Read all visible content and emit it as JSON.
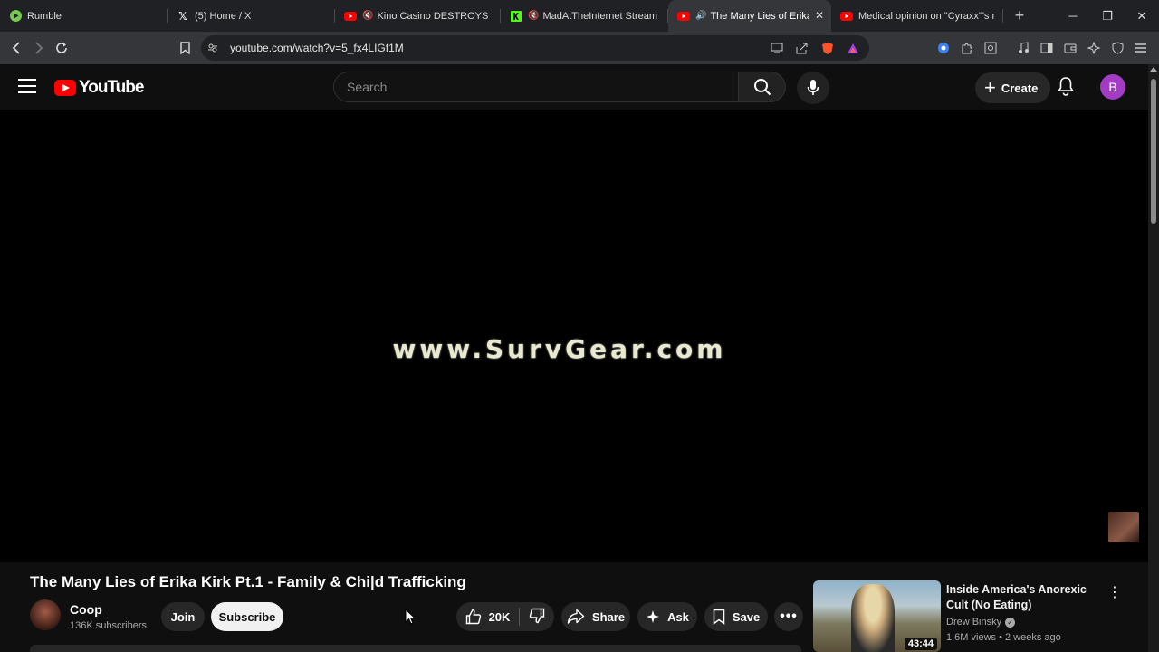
{
  "browser": {
    "tabs": [
      {
        "title": "Rumble",
        "icon": "rumble-icon",
        "color": "#75c94e"
      },
      {
        "title": "(5) Home / X",
        "icon": "x-icon",
        "color": "#ffffff"
      },
      {
        "title": "Kino Casino DESTROYS DSP",
        "icon": "youtube-icon",
        "color": "#ff0000"
      },
      {
        "title": "MadAtTheInternet Stream -",
        "icon": "kick-icon",
        "color": "#53fc18"
      },
      {
        "title": "The Many Lies of Erika K",
        "icon": "youtube-icon",
        "color": "#ff0000"
      },
      {
        "title": "Medical opinion on \"Cyraxx\"'s m",
        "icon": "youtube-icon",
        "color": "#ff0000"
      }
    ],
    "url": "youtube.com/watch?v=5_fx4LIGf1M"
  },
  "youtube": {
    "logo_text": "YouTube",
    "search_placeholder": "Search",
    "create_label": "Create",
    "avatar_letter": "B",
    "accent": "#ff0000"
  },
  "video": {
    "overlay_text": "www.SurvGear.com",
    "title": "The Many Lies of Erika Kirk Pt.1 - Family & Chi|d Trafficking",
    "channel": "Coop",
    "subscribers": "136K subscribers",
    "join_label": "Join",
    "subscribe_label": "Subscribe",
    "likes": "20K",
    "share_label": "Share",
    "ask_label": "Ask",
    "save_label": "Save"
  },
  "recommended": [
    {
      "title": "Inside America's Anorexic Cult (No Eating)",
      "channel": "Drew Binsky",
      "meta": "1.6M views • 2 weeks ago",
      "duration": "43:44"
    }
  ]
}
